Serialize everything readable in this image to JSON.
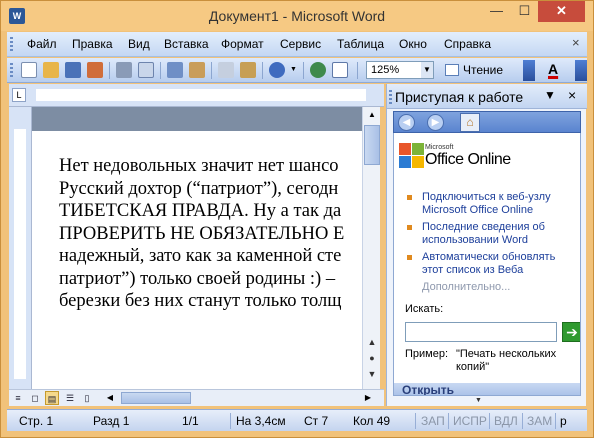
{
  "window": {
    "title": "Документ1 - Microsoft Word",
    "app_icon": "W",
    "minimize": "—",
    "maximize": "☐",
    "close": "✕"
  },
  "menu": {
    "items": [
      "Файл",
      "Правка",
      "Вид",
      "Вставка",
      "Формат",
      "Сервис",
      "Таблица",
      "Окно",
      "Справка"
    ],
    "close": "×"
  },
  "toolbar": {
    "zoom": "125%",
    "read_label": "Чтение",
    "font_color_label": "A"
  },
  "document": {
    "lines": [
      "Нет недовольных значит нет шансо",
      "Русский дохтор (“патриот”), сегодн",
      "ТИБЕТСКАЯ ПРАВДА. Ну а так да",
      "ПРОВЕРИТЬ НЕ ОБЯЗАТЕЛЬНО Е",
      "надежный, зато как за каменной сте",
      "патриот”) только своей родины :) –",
      "березки без них станут только толщ"
    ]
  },
  "taskpane": {
    "title": "Приступая к работе",
    "dropdown": "▼",
    "close": "×",
    "logo_small": "Microsoft",
    "logo_text": "Office Online",
    "links": [
      "Подключиться к веб-узлу Microsoft Office Online",
      "Последние сведения об использовании Word",
      "Автоматически обновлять этот список из Веба"
    ],
    "more": "Дополнительно...",
    "search_label": "Искать:",
    "search_value": "",
    "example_label": "Пример:",
    "example_value": "\"Печать нескольких копий\"",
    "open_label": "Открыть"
  },
  "status": {
    "page": "Стр. 1",
    "section": "Разд 1",
    "pages": "1/1",
    "at": "На 3,4см",
    "line": "Ст 7",
    "col": "Кол 49",
    "rec": "ЗАП",
    "trk": "ИСПР",
    "ext": "ВДЛ",
    "ovr": "ЗАМ",
    "lang": "р"
  },
  "colors": {
    "title_bar": "#f6c983",
    "menu_bar": "#c4d7f3",
    "accent": "#2b5797"
  }
}
